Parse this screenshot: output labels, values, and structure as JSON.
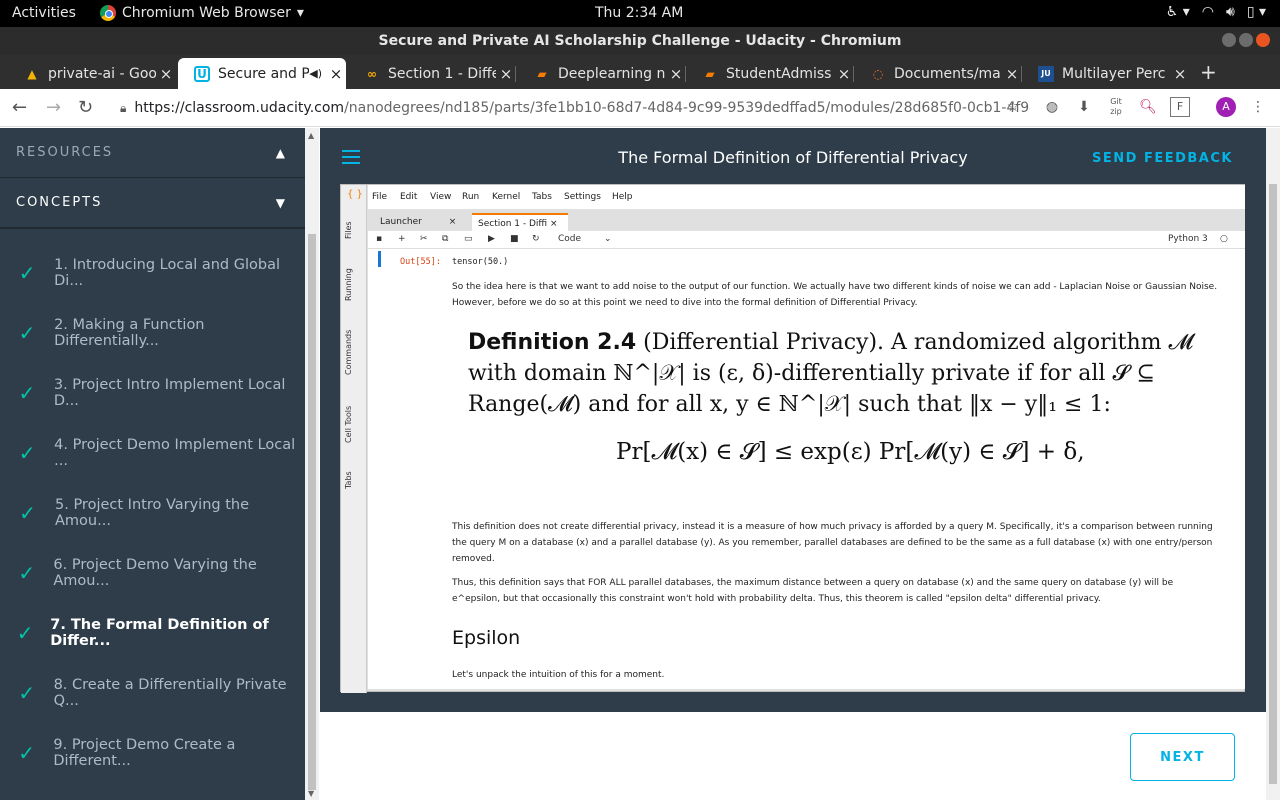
{
  "topbar": {
    "activities": "Activities",
    "app_name": "Chromium Web Browser",
    "clock": "Thu  2:34 AM"
  },
  "window": {
    "title": "Secure and Private AI Scholarship Challenge - Udacity - Chromium"
  },
  "tabs": [
    {
      "label": "private-ai - Goo",
      "icon": "google-drive-icon",
      "active": false
    },
    {
      "label": "Secure and P",
      "icon": "udacity-icon",
      "active": true,
      "audio": true
    },
    {
      "label": "Section 1 - Diffe",
      "icon": "colab-icon",
      "active": false
    },
    {
      "label": "Deeplearning n",
      "icon": "notebook-icon",
      "active": false
    },
    {
      "label": "StudentAdmiss",
      "icon": "notebook-icon",
      "active": false
    },
    {
      "label": "Documents/ma",
      "icon": "jupyter-icon",
      "active": false
    },
    {
      "label": "Multilayer Perc",
      "icon": "jupyter-lab-icon",
      "active": false
    }
  ],
  "address": {
    "host": "https://classroom.udacity.com",
    "path": "/nanodegrees/nd185/parts/3fe1bb10-68d7-4d84-9c99-9539dedffad5/modules/28d685f0-0cb1-4f94-a..."
  },
  "profile": {
    "initial": "A"
  },
  "sidebar": {
    "resources_label": "RESOURCES",
    "concepts_label": "CONCEPTS",
    "concepts": [
      {
        "label": "1. Introducing Local and Global Di...",
        "done": true
      },
      {
        "label": "2. Making a Function Differentially...",
        "done": true
      },
      {
        "label": "3. Project Intro Implement Local D...",
        "done": true
      },
      {
        "label": "4. Project Demo Implement Local ...",
        "done": true
      },
      {
        "label": "5. Project Intro Varying the Amou...",
        "done": true
      },
      {
        "label": "6. Project Demo Varying the Amou...",
        "done": true
      },
      {
        "label": "7. The Formal Definition of Differ...",
        "done": true,
        "current": true
      },
      {
        "label": "8. Create a Differentially Private Q...",
        "done": true
      },
      {
        "label": "9. Project Demo Create a Different...",
        "done": true
      }
    ]
  },
  "header": {
    "title": "The Formal Definition of Differential Privacy",
    "feedback": "SEND FEEDBACK"
  },
  "jupyter": {
    "menu": [
      "File",
      "Edit",
      "View",
      "Run",
      "Kernel",
      "Tabs",
      "Settings",
      "Help"
    ],
    "side_tabs": [
      "Files",
      "Running",
      "Commands",
      "Cell Tools",
      "Tabs"
    ],
    "tabs": [
      "Launcher",
      "Section 1 - Diffi"
    ],
    "cell_type": "Code",
    "kernel": "Python 3",
    "out_prompt": "Out[55]:",
    "out_value": "tensor(50.)",
    "para1": "So the idea here is that we want to add noise to the output of our function. We actually have two different kinds of noise we can add - Laplacian Noise or Gaussian Noise. However, before we do so at this point we need to dive into the formal definition of Differential Privacy.",
    "def_title": "Definition 2.4",
    "def_paren": "(Differential Privacy).",
    "def_body": "A randomized algorithm 𝓜 with domain ℕ^|𝒳| is (ε, δ)-differentially private if for all 𝓢 ⊆ Range(𝓜) and for all x, y ∈ ℕ^|𝒳| such that ‖x − y‖₁ ≤ 1:",
    "formula": "Pr[𝓜(x) ∈ 𝓢] ≤ exp(ε) Pr[𝓜(y) ∈ 𝓢] + δ,",
    "para2": "This definition does not create differential privacy, instead it is a measure of how much privacy is afforded by a query M. Specifically, it's a comparison between running the query M on a database (x) and a parallel database (y). As you remember, parallel databases are defined to be the same as a full database (x) with one entry/person removed.",
    "para3": "Thus, this definition says that FOR ALL parallel databases, the maximum distance between a query on database (x) and the same query on database (y) will be e^epsilon, but that occasionally this constraint won't hold with probability delta. Thus, this theorem is called \"epsilon delta\" differential privacy.",
    "epsilon_heading": "Epsilon",
    "para4": "Let's unpack the intuition of this for a moment."
  },
  "next_label": "NEXT"
}
